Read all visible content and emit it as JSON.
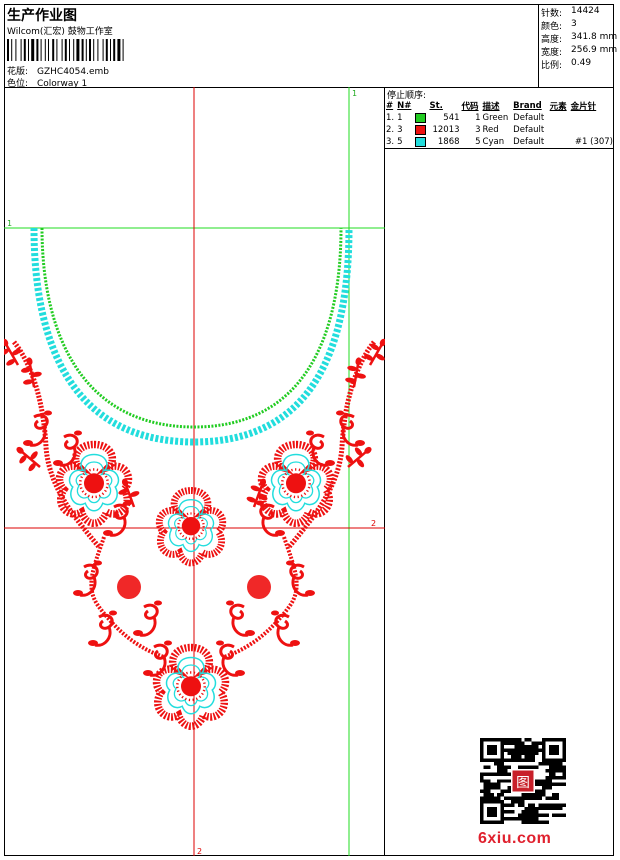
{
  "header": {
    "title": "生产作业图",
    "company": "Wilcom(汇宏) 鼓物工作室",
    "design_label": "花版:",
    "design_value": "GZHC4054.emb",
    "colorway_label": "色位:",
    "colorway_value": "Colorway 1"
  },
  "stats": [
    {
      "label": "针数:",
      "value": "14424"
    },
    {
      "label": "颜色:",
      "value": "3"
    },
    {
      "label": "高度:",
      "value": "341.8 mm"
    },
    {
      "label": "宽度:",
      "value": "256.9 mm"
    },
    {
      "label": "比例:",
      "value": "0.49"
    }
  ],
  "stop_sequence": {
    "title": "停止顺序:",
    "columns": [
      "#",
      "N#",
      "St.",
      "代码",
      "描述",
      "Brand",
      "元素",
      "金片针"
    ],
    "rows": [
      {
        "idx": "1.",
        "n": "1",
        "color": "#22cc22",
        "st": "541",
        "code": "1",
        "desc": "Green",
        "brand": "Default",
        "elem": "",
        "seq": ""
      },
      {
        "idx": "2.",
        "n": "3",
        "color": "#ee1111",
        "st": "12013",
        "code": "3",
        "desc": "Red",
        "brand": "Default",
        "elem": "",
        "seq": ""
      },
      {
        "idx": "3.",
        "n": "5",
        "color": "#22dddd",
        "st": "1868",
        "code": "5",
        "desc": "Cyan",
        "brand": "Default",
        "elem": "",
        "seq": "#1 (307)"
      }
    ]
  },
  "guides": {
    "v1_label": "1",
    "h1_label": "1",
    "h2_label": "2",
    "v2_label": "2"
  },
  "watermark": {
    "site": "6xiu.com",
    "seal_text": "图"
  }
}
